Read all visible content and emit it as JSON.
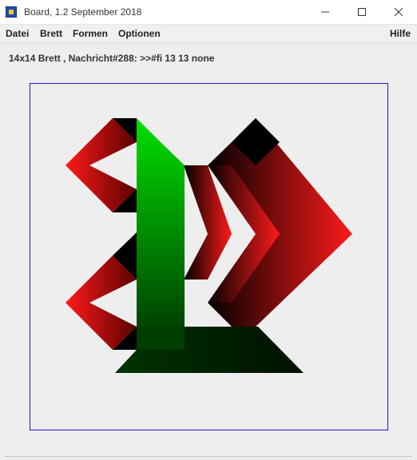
{
  "window": {
    "title": "Board, 1.2 September 2018",
    "icon": "board-app-icon",
    "controls": [
      "minimize-icon",
      "maximize-icon",
      "close-icon"
    ]
  },
  "menu": {
    "datei": "Datei",
    "brett": "Brett",
    "formen": "Formen",
    "optionen": "Optionen",
    "hilfe": "Hilfe"
  },
  "status": {
    "message": "14x14 Brett , Nachricht#288: >>#fi 13 13 none"
  },
  "board": {
    "size": 14,
    "border_color": "#1a1acc",
    "colors": {
      "red": "#ff1a1a",
      "dark_red": "#5a0000",
      "black": "#000000",
      "green": "#00e000",
      "dark_green": "#003300",
      "background": "#eeeeee"
    }
  }
}
